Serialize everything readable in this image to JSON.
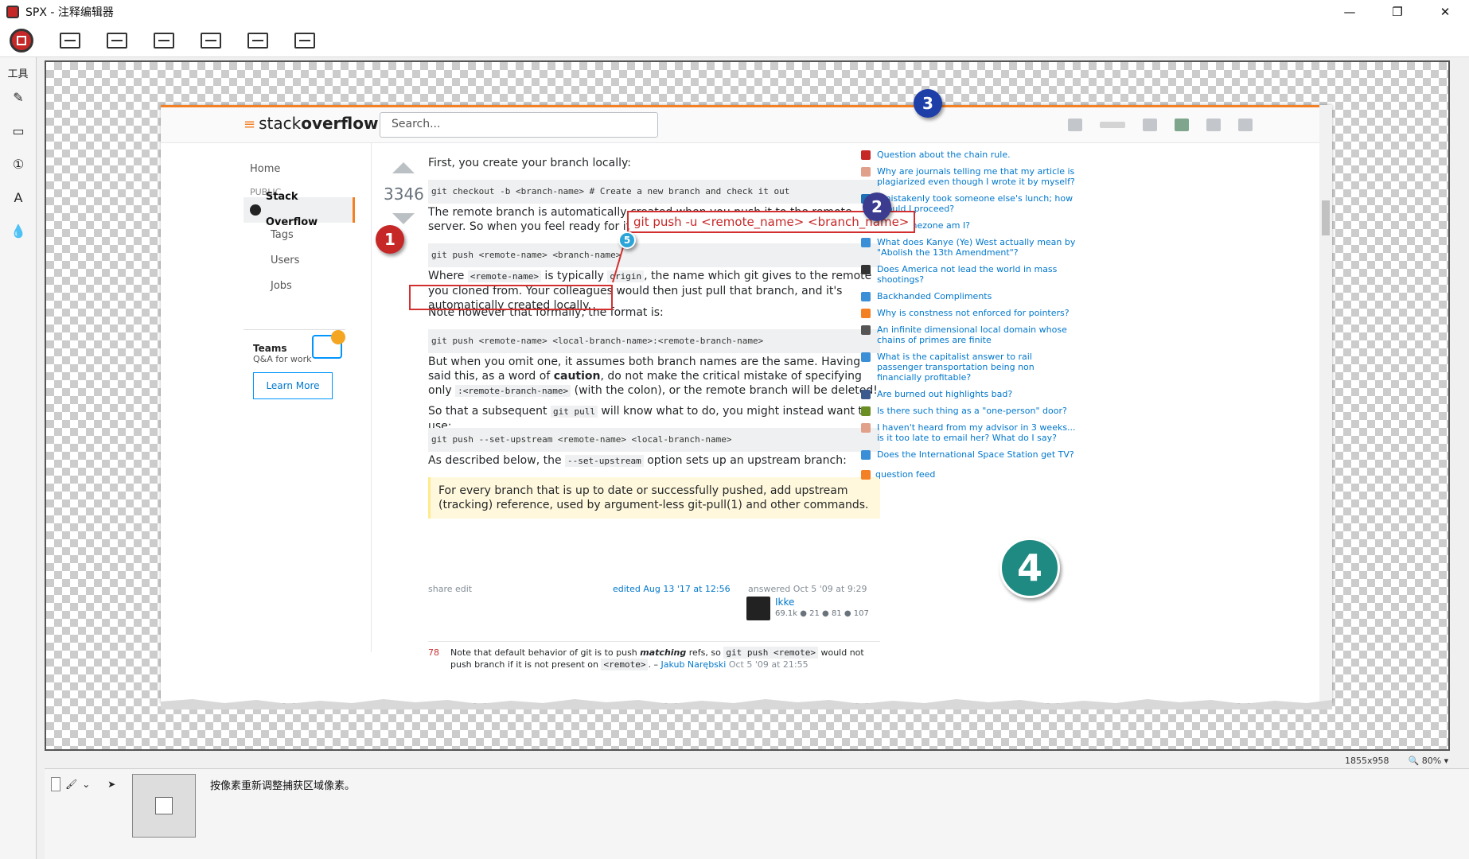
{
  "window": {
    "title": "SPX - 注释编辑器",
    "minimize": "—",
    "restore": "❐",
    "close": "✕"
  },
  "left_panel": {
    "tools_label": "工具"
  },
  "so": {
    "logo_text_1": "stack",
    "logo_text_2": "overflow",
    "search_placeholder": "Search...",
    "nav": {
      "home": "Home",
      "public": "PUBLIC",
      "stackoverflow": "Stack Overflow",
      "tags": "Tags",
      "users": "Users",
      "jobs": "Jobs"
    },
    "teams": {
      "title": "Teams",
      "subtitle": "Q&A for work",
      "learn_more": "Learn More"
    },
    "vote_count": "3346",
    "answer": {
      "p1": "First, you create your branch locally:",
      "code1": "git checkout -b <branch-name> # Create a new branch and check it out",
      "p2": "The remote branch is automatically created when you push it to the remote server. So when you feel ready for it, you can just do:",
      "code2": "git push <remote-name> <branch-name>",
      "p3a": "Where ",
      "p3_inl1": "<remote-name>",
      "p3b": " is typically ",
      "p3_inl2": "origin",
      "p3c": ", the name which git gives to the remote you cloned from. Your colleagues would then just pull that branch, and it's automatically created locally.",
      "p4": "Note however that formally, the format is:",
      "code3": "git push <remote-name> <local-branch-name>:<remote-branch-name>",
      "p5a": "But when you omit one, it assumes both branch names are the same. Having said this, as a word of ",
      "p5_bold": "caution",
      "p5b": ", do not make the critical mistake of specifying only ",
      "p5_inl": ":<remote-branch-name>",
      "p5c": " (with the colon), or the remote branch will be deleted!",
      "p6a": "So that a subsequent ",
      "p6_inl": "git pull",
      "p6b": " will know what to do, you might instead want to use:",
      "code4": "git push --set-upstream <remote-name> <local-branch-name>",
      "p7a": "As described below, the ",
      "p7_inl": "--set-upstream",
      "p7b": " option sets up an upstream branch:",
      "quote": "For every branch that is up to date or successfully pushed, add upstream (tracking) reference, used by argument-less git-pull(1) and other commands."
    },
    "meta": {
      "share": "share  edit",
      "edited": "edited Aug 13 '17 at 12:56",
      "answered": "answered Oct 5 '09 at 9:29",
      "user_name": "Ikke",
      "user_rep": "69.1k ● 21 ● 81 ● 107"
    },
    "comment": {
      "num": "78",
      "text_a": "Note that default behavior of git is to push ",
      "text_bold": "matching",
      "text_b": " refs, so ",
      "inl1": "git push <remote>",
      "text_c": " would not push branch if it is not present on ",
      "inl2": "<remote>",
      "text_d": ". – ",
      "author": "Jakub Narębski",
      "date": " Oct 5 '09 at 21:55"
    },
    "hot_questions": [
      {
        "text": "Question about the chain rule.",
        "color": "#c62828"
      },
      {
        "text": "Why are journals telling me that my article is plagiarized even though I wrote it by myself?",
        "color": "#e0a08a"
      },
      {
        "text": "I mistakenly took someone else's lunch; how should I proceed?",
        "color": "#1d6fb8"
      },
      {
        "text": "What timezone am I?",
        "color": "#888888"
      },
      {
        "text": "What does Kanye (Ye) West actually mean by \"Abolish the 13th Amendment\"?",
        "color": "#3a8fd6"
      },
      {
        "text": "Does America not lead the world in mass shootings?",
        "color": "#333333"
      },
      {
        "text": "Backhanded Compliments",
        "color": "#3a8fd6"
      },
      {
        "text": "Why is constness not enforced for pointers?",
        "color": "#f48024"
      },
      {
        "text": "An infinite dimensional local domain whose chains of primes are finite",
        "color": "#555555"
      },
      {
        "text": "What is the capitalist answer to rail passenger transportation being non financially profitable?",
        "color": "#3a8fd6"
      },
      {
        "text": "Are burned out highlights bad?",
        "color": "#3b5b8f"
      },
      {
        "text": "Is there such thing as a \"one-person\" door?",
        "color": "#6b8e23"
      },
      {
        "text": "I haven't heard from my advisor in 3 weeks... is it too late to email her? What do I say?",
        "color": "#e0a08a"
      },
      {
        "text": "Does the International Space Station get TV?",
        "color": "#3a8fd6"
      }
    ],
    "question_feed": "question feed"
  },
  "annotations": {
    "n1": "1",
    "n2": "2",
    "n3": "3",
    "n4": "4",
    "n5": "5",
    "callout": "git push -u <remote_name> <branch_name>"
  },
  "status": {
    "size": "1855x958",
    "zoom": "80%"
  },
  "bottom": {
    "hint": "按像素重新调整捕获区域像素。"
  }
}
